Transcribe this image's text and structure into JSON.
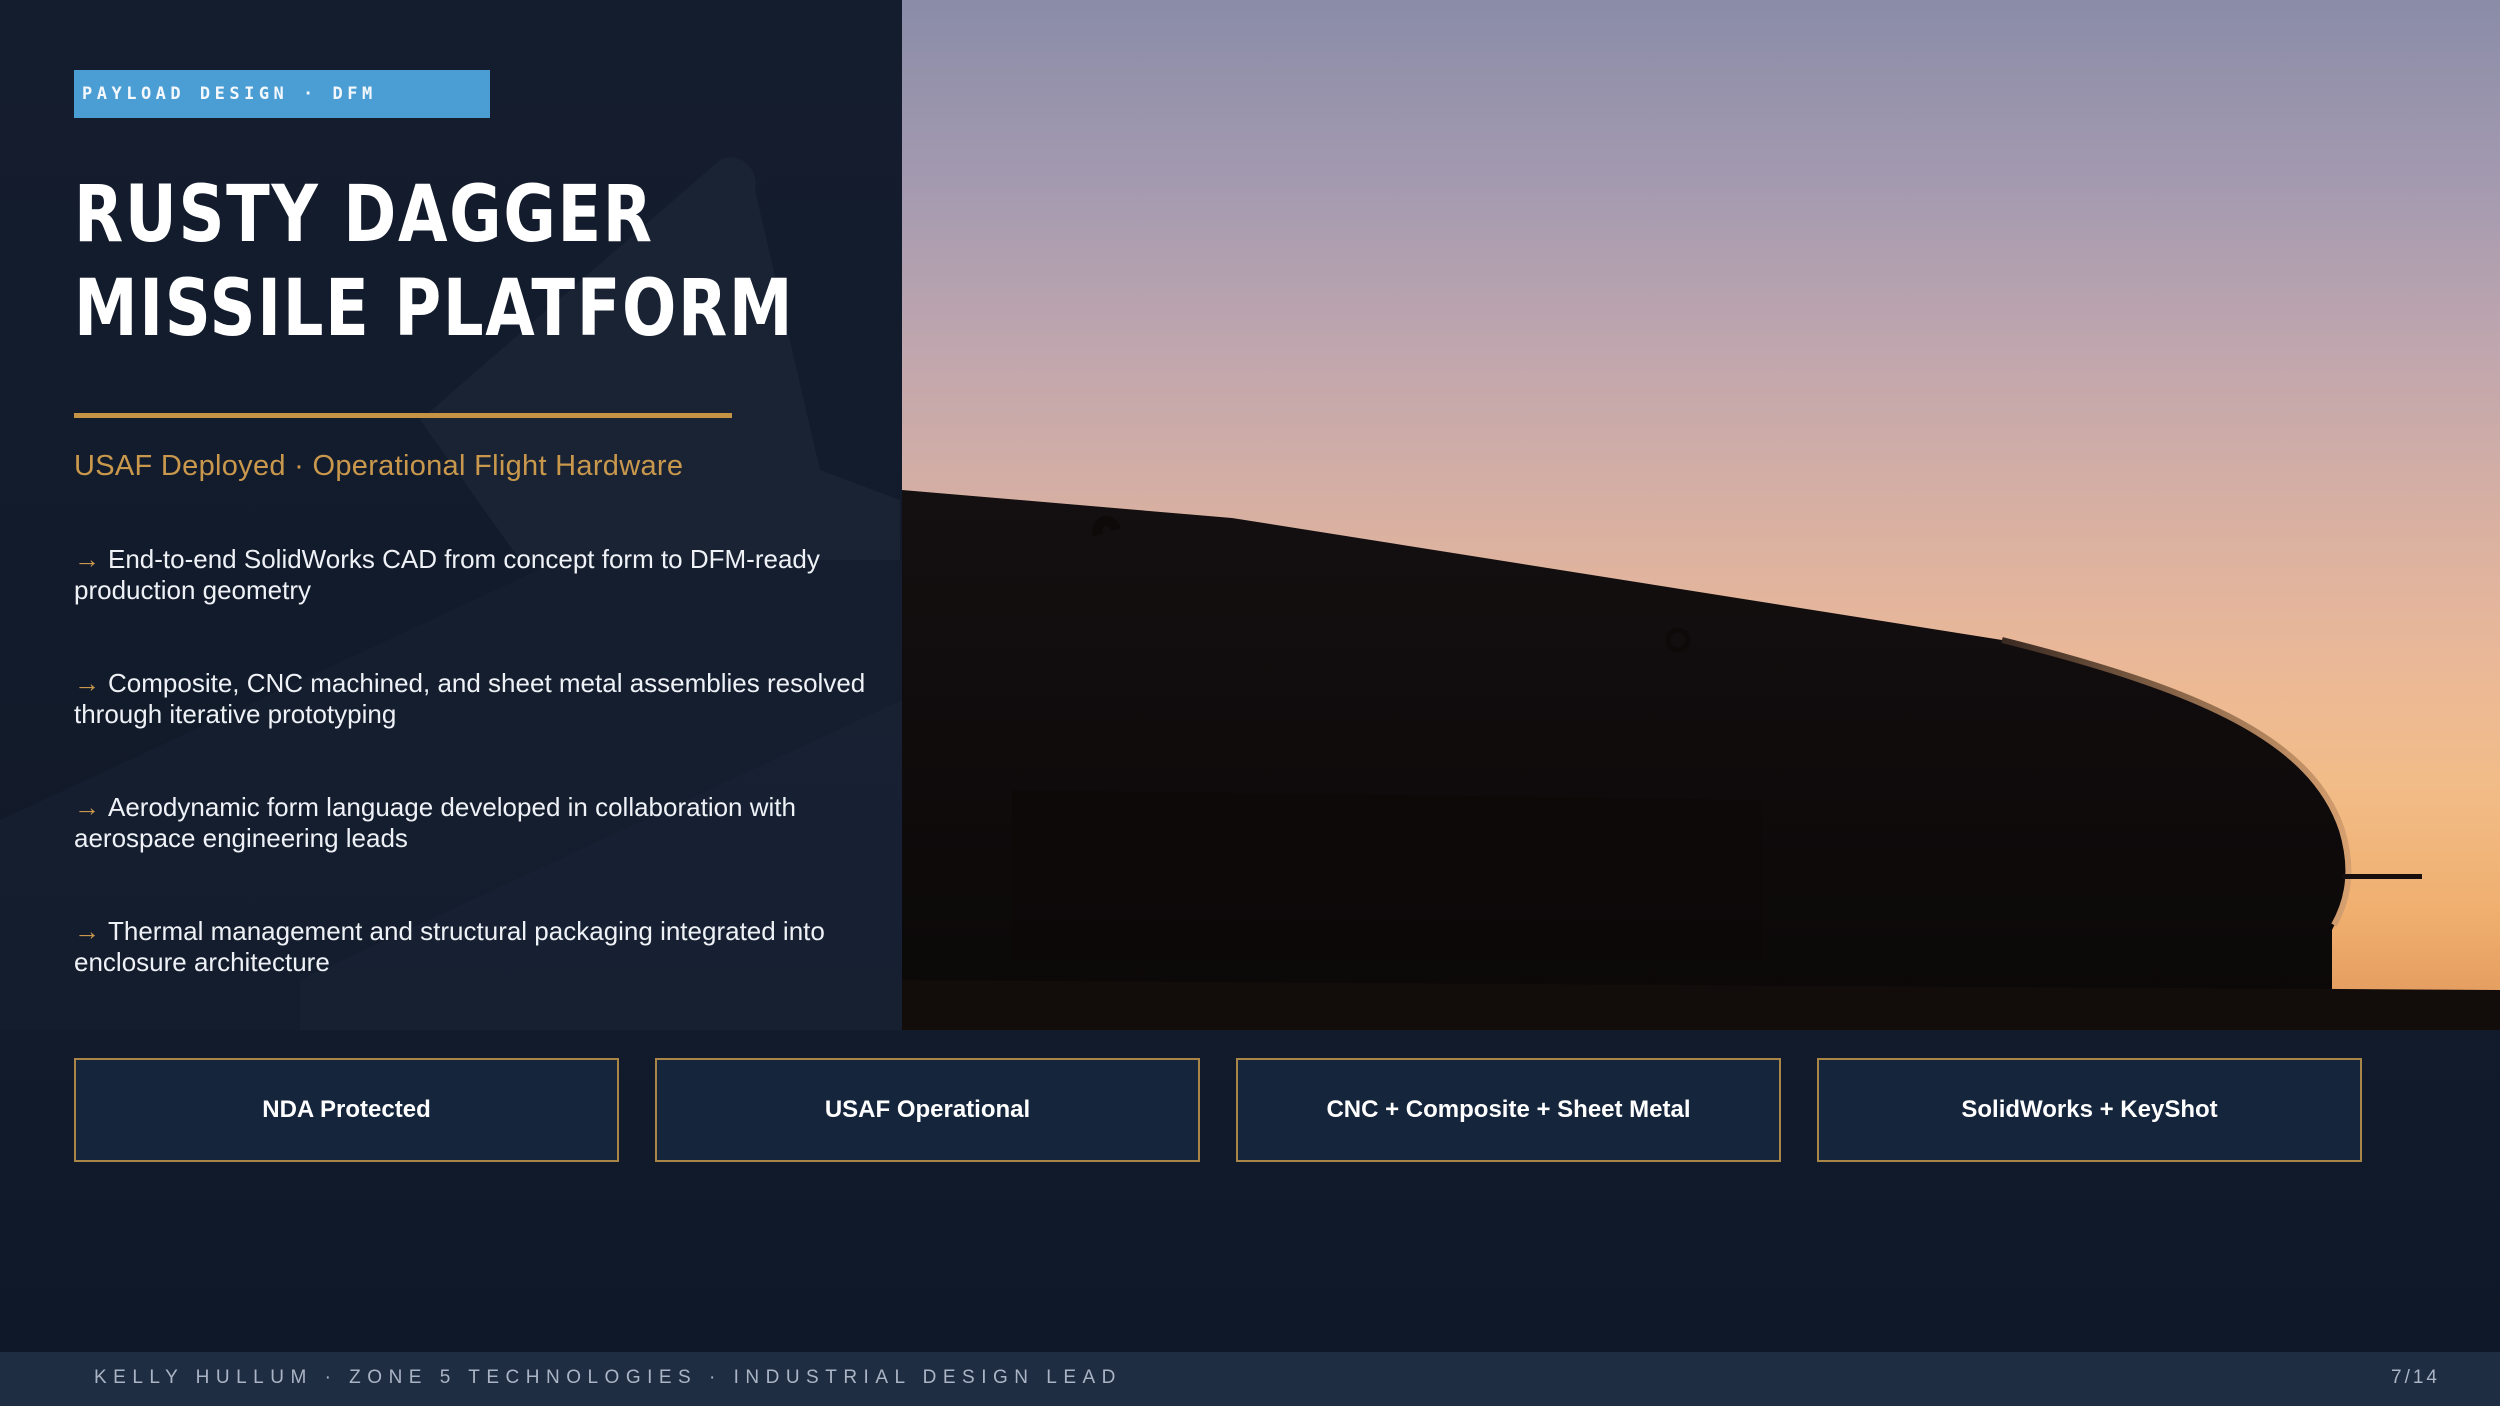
{
  "slide": {
    "kicker": "PAYLOAD DESIGN · DFM",
    "title_line1": "RUSTY DAGGER",
    "title_line2": "MISSILE PLATFORM",
    "subtitle": "USAF Deployed · Operational Flight Hardware",
    "bullet_arrow": "→",
    "bullets": [
      "End-to-end SolidWorks CAD from concept form to DFM-ready production geometry",
      "Composite, CNC machined, and sheet metal assemblies resolved through iterative prototyping",
      "Aerodynamic form language developed in collaboration with aerospace engineering leads",
      "Thermal management and structural packaging integrated into enclosure architecture"
    ],
    "badges": [
      "NDA Protected",
      "USAF Operational",
      "CNC + Composite + Sheet Metal",
      "SolidWorks + KeyShot"
    ]
  },
  "footer": {
    "credit": "KELLY HULLUM  ·  ZONE 5 TECHNOLOGIES  ·  INDUSTRIAL DESIGN LEAD",
    "page": "7/14"
  },
  "colors": {
    "background": "#0f1a2b",
    "kicker_bg": "#4a9ed4",
    "accent_gold": "#c49444",
    "badge_bg": "#15253c",
    "footer_bg": "#1f2d43"
  },
  "icons": {
    "bullet": "right-arrow-icon"
  }
}
